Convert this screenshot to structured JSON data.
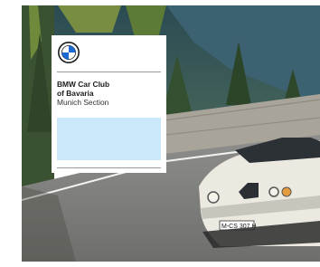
{
  "club": {
    "name_line1": "BMW Car Club",
    "name_line2": "of Bavaria",
    "section": "Munich Section"
  },
  "car": {
    "plate": "M-CS 307 H"
  },
  "colors": {
    "accent_box": "#c9e8fa",
    "bmw_blue": "#1c69d4"
  },
  "icons": [
    "bmw-roundel-icon"
  ]
}
